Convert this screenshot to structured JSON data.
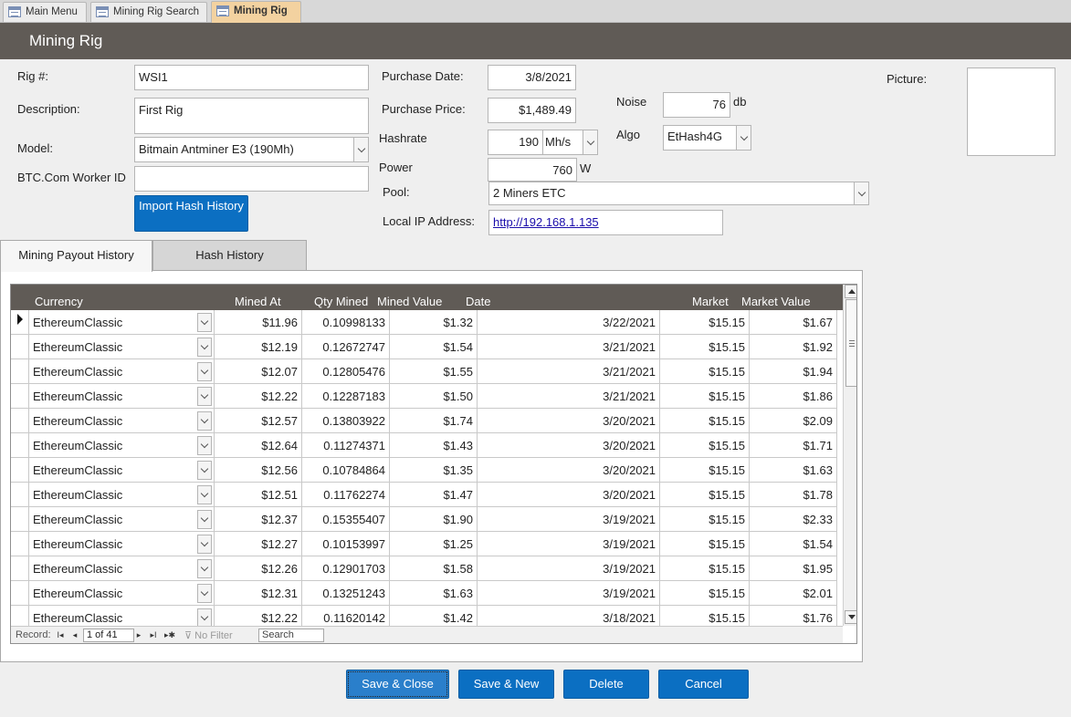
{
  "doc_tabs": [
    {
      "label": "Main Menu"
    },
    {
      "label": "Mining Rig Search"
    },
    {
      "label": "Mining Rig"
    }
  ],
  "header": {
    "title": "Mining Rig"
  },
  "form": {
    "rig_label": "Rig #:",
    "rig_value": "WSI1",
    "description_label": "Description:",
    "description_value": "First Rig",
    "model_label": "Model:",
    "model_value": "Bitmain Antminer E3 (190Mh)",
    "worker_label": "BTC.Com Worker ID",
    "worker_value": "",
    "import_button": "Import Hash History",
    "purchase_date_label": "Purchase Date:",
    "purchase_date_value": "3/8/2021",
    "purchase_price_label": "Purchase Price:",
    "purchase_price_value": "$1,489.49",
    "hashrate_label": "Hashrate",
    "hashrate_value": "190",
    "hashrate_unit": "Mh/s",
    "power_label": "Power",
    "power_value": "760",
    "power_unit": "W",
    "pool_label": "Pool:",
    "pool_value": "2 Miners ETC",
    "ip_label": "Local IP Address:",
    "ip_value": "http://192.168.1.135",
    "noise_label": "Noise",
    "noise_value": "76",
    "noise_unit": "db",
    "algo_label": "Algo",
    "algo_value": "EtHash4G",
    "picture_label": "Picture:"
  },
  "subtabs": {
    "payout": "Mining Payout History",
    "hash": "Hash History"
  },
  "grid": {
    "columns": [
      "Currency",
      "Mined At",
      "Qty Mined",
      "Mined Value",
      "Date",
      "Market",
      "Market Value"
    ],
    "rows": [
      [
        "EthereumClassic",
        "$11.96",
        "0.10998133",
        "$1.32",
        "3/22/2021",
        "$15.15",
        "$1.67"
      ],
      [
        "EthereumClassic",
        "$12.19",
        "0.12672747",
        "$1.54",
        "3/21/2021",
        "$15.15",
        "$1.92"
      ],
      [
        "EthereumClassic",
        "$12.07",
        "0.12805476",
        "$1.55",
        "3/21/2021",
        "$15.15",
        "$1.94"
      ],
      [
        "EthereumClassic",
        "$12.22",
        "0.12287183",
        "$1.50",
        "3/21/2021",
        "$15.15",
        "$1.86"
      ],
      [
        "EthereumClassic",
        "$12.57",
        "0.13803922",
        "$1.74",
        "3/20/2021",
        "$15.15",
        "$2.09"
      ],
      [
        "EthereumClassic",
        "$12.64",
        "0.11274371",
        "$1.43",
        "3/20/2021",
        "$15.15",
        "$1.71"
      ],
      [
        "EthereumClassic",
        "$12.56",
        "0.10784864",
        "$1.35",
        "3/20/2021",
        "$15.15",
        "$1.63"
      ],
      [
        "EthereumClassic",
        "$12.51",
        "0.11762274",
        "$1.47",
        "3/20/2021",
        "$15.15",
        "$1.78"
      ],
      [
        "EthereumClassic",
        "$12.37",
        "0.15355407",
        "$1.90",
        "3/19/2021",
        "$15.15",
        "$2.33"
      ],
      [
        "EthereumClassic",
        "$12.27",
        "0.10153997",
        "$1.25",
        "3/19/2021",
        "$15.15",
        "$1.54"
      ],
      [
        "EthereumClassic",
        "$12.26",
        "0.12901703",
        "$1.58",
        "3/19/2021",
        "$15.15",
        "$1.95"
      ],
      [
        "EthereumClassic",
        "$12.31",
        "0.13251243",
        "$1.63",
        "3/19/2021",
        "$15.15",
        "$2.01"
      ],
      [
        "EthereumClassic",
        "$12.22",
        "0.11620142",
        "$1.42",
        "3/18/2021",
        "$15.15",
        "$1.76"
      ]
    ]
  },
  "navbar": {
    "record_label": "Record:",
    "first": "I◂",
    "prev": "◂",
    "current": "1 of 41",
    "next": "▸",
    "last": "▸I",
    "new": "▸✱",
    "filter": "No Filter",
    "search": "Search"
  },
  "buttons": {
    "save_close": "Save & Close",
    "save_new": "Save & New",
    "delete": "Delete",
    "cancel": "Cancel"
  }
}
